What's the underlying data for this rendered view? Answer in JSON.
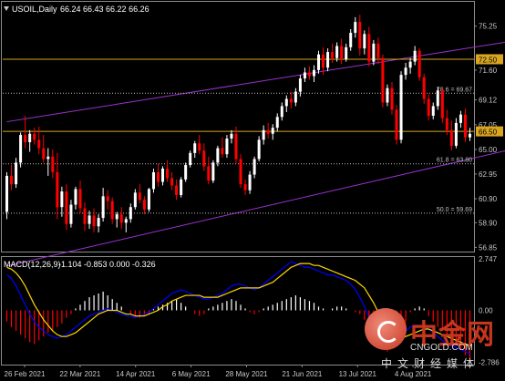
{
  "header": {
    "symbol": "USOIL,Daily",
    "ohlc": "66.24 66.43 66.22 66.26"
  },
  "macd_header": {
    "label": "MACD(12,26,9)",
    "values": "-1.104 -0.853 0.000 -0.326"
  },
  "colors": {
    "background": "#000000",
    "bull": "#ffffff",
    "bear": "#ff0000",
    "channel": "#9932cc",
    "hline": "#daa520",
    "fib": "#c0c0c0",
    "macd_hist_up": "#ffffff",
    "macd_hist_down": "#ff0000",
    "macd_line": "#0000ff",
    "signal_line": "#ffd700",
    "axis_text": "#c8c8c8"
  },
  "watermark": {
    "title": "中金网",
    "url": "CNGOLD.COM",
    "subtitle": "中文财经媒体"
  },
  "chart_data": [
    {
      "type": "candlestick",
      "title": "USOIL,Daily",
      "ylim": [
        56.5,
        77.2
      ],
      "y_ticks": [
        "75.25",
        "72.50",
        "71.60",
        "69.12",
        "67.05",
        "66.50",
        "65.00",
        "62.95",
        "60.90",
        "58.90",
        "56.85"
      ],
      "x_ticks": [
        "26 Feb 2021",
        "22 Mar 2021",
        "14 Apr 2021",
        "6 May 2021",
        "28 May 2021",
        "21 Jun 2021",
        "13 Jul 2021",
        "4 Aug 2021"
      ],
      "price_tags": [
        {
          "label": "72.50",
          "value": 72.5
        },
        {
          "label": "66.50",
          "value": 66.5
        }
      ],
      "horizontal_lines": [
        72.5,
        66.5
      ],
      "fib_levels": [
        {
          "label": "78.6 = 69.67",
          "value": 69.67
        },
        {
          "label": "61.8 = 63.80",
          "value": 63.8
        },
        {
          "label": "50.0 = 59.69",
          "value": 59.69
        }
      ],
      "channel": {
        "upper": [
          [
            0,
            67.3
          ],
          [
            161,
            77.1
          ]
        ],
        "lower": [
          [
            0,
            55.3
          ],
          [
            160,
            69.4
          ]
        ]
      },
      "candles": [
        [
          59.8,
          63.1,
          59.2,
          62.8
        ],
        [
          62.8,
          63.7,
          61.6,
          62.1
        ],
        [
          62.1,
          64.3,
          61.8,
          63.9
        ],
        [
          63.9,
          66.4,
          63.5,
          66.2
        ],
        [
          66.2,
          67.8,
          65.1,
          65.6
        ],
        [
          65.6,
          66.6,
          64.8,
          66.3
        ],
        [
          66.3,
          66.8,
          65.4,
          65.8
        ],
        [
          65.8,
          66.9,
          64.6,
          65.1
        ],
        [
          65.1,
          66.2,
          63.9,
          64.2
        ],
        [
          64.2,
          65.1,
          62.8,
          64.4
        ],
        [
          64.4,
          65.0,
          62.6,
          63.1
        ],
        [
          63.1,
          64.7,
          59.2,
          60.2
        ],
        [
          60.2,
          61.9,
          59.4,
          61.5
        ],
        [
          61.5,
          62.1,
          58.3,
          58.8
        ],
        [
          58.8,
          60.8,
          58.5,
          60.4
        ],
        [
          60.4,
          61.9,
          60.0,
          61.7
        ],
        [
          61.7,
          62.4,
          59.7,
          60.1
        ],
        [
          60.1,
          60.6,
          58.2,
          58.8
        ],
        [
          58.8,
          59.9,
          58.4,
          59.5
        ],
        [
          59.5,
          60.1,
          58.1,
          58.6
        ],
        [
          58.6,
          59.6,
          58.1,
          59.3
        ],
        [
          59.3,
          61.8,
          59.0,
          61.1
        ],
        [
          61.1,
          61.6,
          60.0,
          60.7
        ],
        [
          60.7,
          61.0,
          58.8,
          59.2
        ],
        [
          59.2,
          59.8,
          58.5,
          59.6
        ],
        [
          59.6,
          60.2,
          58.4,
          58.9
        ],
        [
          58.9,
          59.4,
          58.1,
          59.2
        ],
        [
          59.2,
          60.5,
          58.9,
          60.2
        ],
        [
          60.2,
          61.7,
          60.0,
          61.4
        ],
        [
          61.4,
          62.1,
          60.5,
          60.8
        ],
        [
          60.8,
          61.1,
          59.6,
          60.0
        ],
        [
          60.0,
          61.8,
          59.8,
          61.7
        ],
        [
          61.7,
          63.4,
          61.4,
          63.1
        ],
        [
          63.1,
          63.8,
          61.9,
          62.3
        ],
        [
          62.3,
          63.6,
          62.0,
          63.4
        ],
        [
          63.4,
          64.1,
          62.3,
          62.6
        ],
        [
          62.6,
          63.1,
          61.6,
          62.0
        ],
        [
          62.0,
          62.5,
          60.8,
          61.2
        ],
        [
          61.2,
          62.7,
          61.0,
          62.5
        ],
        [
          62.5,
          63.9,
          62.3,
          63.7
        ],
        [
          63.7,
          64.9,
          63.5,
          64.7
        ],
        [
          64.7,
          65.7,
          64.3,
          65.5
        ],
        [
          65.5,
          66.2,
          64.6,
          64.9
        ],
        [
          64.9,
          65.5,
          63.2,
          63.6
        ],
        [
          63.6,
          64.4,
          62.1,
          62.4
        ],
        [
          62.4,
          64.1,
          62.2,
          63.9
        ],
        [
          63.9,
          65.3,
          63.6,
          65.1
        ],
        [
          65.1,
          66.0,
          64.3,
          64.6
        ],
        [
          64.6,
          66.2,
          64.3,
          65.9
        ],
        [
          65.9,
          66.6,
          65.5,
          66.3
        ],
        [
          66.3,
          66.9,
          63.8,
          64.2
        ],
        [
          64.2,
          64.6,
          61.8,
          62.1
        ],
        [
          62.1,
          62.5,
          61.2,
          61.6
        ],
        [
          61.6,
          63.2,
          61.3,
          62.9
        ],
        [
          62.9,
          64.4,
          62.6,
          64.2
        ],
        [
          64.2,
          66.1,
          64.0,
          65.8
        ],
        [
          65.8,
          67.0,
          65.4,
          66.6
        ],
        [
          66.6,
          67.2,
          65.9,
          66.3
        ],
        [
          66.3,
          67.1,
          65.8,
          66.8
        ],
        [
          66.8,
          68.0,
          66.5,
          67.7
        ],
        [
          67.7,
          68.9,
          67.4,
          68.6
        ],
        [
          68.6,
          69.5,
          68.1,
          69.2
        ],
        [
          69.2,
          69.8,
          68.4,
          68.9
        ],
        [
          68.9,
          70.1,
          68.6,
          69.8
        ],
        [
          69.8,
          71.2,
          69.4,
          70.9
        ],
        [
          70.9,
          71.8,
          70.6,
          71.4
        ],
        [
          71.4,
          71.9,
          70.8,
          71.1
        ],
        [
          71.1,
          72.0,
          70.6,
          71.6
        ],
        [
          71.6,
          73.2,
          71.3,
          72.9
        ],
        [
          72.9,
          73.5,
          71.2,
          71.8
        ],
        [
          71.8,
          73.4,
          71.5,
          73.1
        ],
        [
          73.1,
          73.8,
          72.2,
          72.6
        ],
        [
          72.6,
          73.9,
          72.3,
          73.6
        ],
        [
          73.6,
          74.2,
          72.1,
          72.5
        ],
        [
          72.5,
          73.8,
          72.3,
          73.5
        ],
        [
          73.5,
          75.0,
          73.2,
          74.7
        ],
        [
          74.7,
          76.0,
          74.3,
          75.6
        ],
        [
          75.6,
          76.2,
          72.8,
          73.4
        ],
        [
          73.4,
          74.9,
          72.9,
          74.6
        ],
        [
          74.6,
          75.2,
          71.9,
          72.3
        ],
        [
          72.3,
          74.1,
          72.0,
          73.8
        ],
        [
          73.8,
          74.3,
          72.1,
          72.6
        ],
        [
          72.6,
          72.9,
          68.5,
          68.9
        ],
        [
          68.9,
          70.4,
          68.6,
          70.1
        ],
        [
          70.1,
          70.6,
          67.9,
          68.3
        ],
        [
          68.3,
          68.7,
          65.4,
          65.8
        ],
        [
          65.8,
          71.5,
          65.5,
          71.2
        ],
        [
          71.2,
          72.2,
          70.8,
          71.8
        ],
        [
          71.8,
          72.6,
          71.3,
          72.3
        ],
        [
          72.3,
          73.6,
          72.0,
          73.2
        ],
        [
          73.2,
          73.4,
          70.7,
          71.0
        ],
        [
          71.0,
          71.3,
          68.8,
          69.2
        ],
        [
          69.2,
          69.6,
          67.4,
          67.8
        ],
        [
          67.8,
          68.9,
          67.5,
          68.6
        ],
        [
          68.6,
          70.2,
          68.3,
          69.9
        ],
        [
          69.9,
          70.1,
          67.2,
          67.6
        ],
        [
          67.6,
          68.3,
          66.2,
          66.6
        ],
        [
          66.6,
          67.4,
          64.9,
          65.3
        ],
        [
          65.3,
          67.6,
          65.1,
          67.2
        ],
        [
          67.2,
          68.2,
          66.8,
          67.9
        ],
        [
          67.9,
          68.4,
          65.6,
          66.0
        ],
        [
          66.0,
          66.8,
          65.7,
          66.3
        ]
      ]
    },
    {
      "type": "bar+line",
      "title": "MACD(12,26,9)",
      "ylim": [
        -2.9,
        2.8
      ],
      "y_ticks": [
        "2.747",
        "0.00",
        "-2.786"
      ],
      "histogram": [
        -0.6,
        -0.9,
        -1.1,
        -1.3,
        -1.5,
        -1.7,
        -1.8,
        -1.6,
        -1.4,
        -1.2,
        -1.1,
        -0.9,
        -0.7,
        -0.4,
        -0.2,
        0.1,
        0.3,
        0.5,
        0.7,
        0.8,
        0.9,
        1.0,
        0.8,
        0.6,
        0.4,
        0.2,
        0.0,
        -0.2,
        -0.3,
        -0.4,
        -0.3,
        -0.2,
        0.1,
        0.2,
        0.3,
        0.4,
        0.5,
        0.6,
        0.4,
        0.2,
        0.0,
        -0.2,
        -0.3,
        -0.2,
        0.1,
        0.2,
        0.3,
        0.4,
        0.5,
        0.6,
        0.5,
        0.3,
        0.1,
        -0.1,
        -0.2,
        -0.1,
        0.1,
        0.2,
        0.3,
        0.4,
        0.5,
        0.6,
        0.7,
        0.8,
        0.7,
        0.6,
        0.5,
        0.4,
        0.2,
        0.1,
        0.0,
        0.1,
        0.2,
        0.2,
        0.1,
        0.0,
        -0.1,
        -0.2,
        -0.5,
        -0.9,
        -1.3,
        -1.7,
        -2.0,
        -2.2,
        -2.0,
        -1.6,
        -1.2,
        -0.6,
        -0.1,
        0.1,
        0.2,
        0.1,
        -0.3,
        -0.6,
        -0.9,
        -1.1,
        -1.4,
        -1.6,
        -1.8,
        -2.1,
        -2.4,
        -2.6
      ],
      "macd_line": [
        1.9,
        1.7,
        1.3,
        0.8,
        0.3,
        -0.2,
        -0.6,
        -0.9,
        -1.1,
        -1.3,
        -1.4,
        -1.5,
        -1.4,
        -1.3,
        -1.1,
        -0.9,
        -0.7,
        -0.5,
        -0.3,
        -0.2,
        -0.1,
        0.0,
        0.1,
        0.0,
        -0.1,
        -0.2,
        -0.3,
        -0.3,
        -0.4,
        -0.3,
        -0.2,
        -0.1,
        0.1,
        0.3,
        0.5,
        0.7,
        0.9,
        1.0,
        1.1,
        1.0,
        0.9,
        0.8,
        0.7,
        0.6,
        0.6,
        0.7,
        0.8,
        0.9,
        1.1,
        1.3,
        1.4,
        1.4,
        1.3,
        1.2,
        1.1,
        1.2,
        1.4,
        1.6,
        1.8,
        2.0,
        2.2,
        2.4,
        2.6,
        2.5,
        2.4,
        2.3,
        2.3,
        2.2,
        2.1,
        2.0,
        1.9,
        1.9,
        1.8,
        1.7,
        1.6,
        1.4,
        1.1,
        0.7,
        0.2,
        -0.4,
        -0.9,
        -1.4,
        -1.8,
        -2.0,
        -1.9,
        -1.7,
        -1.4,
        -1.1,
        -0.9,
        -0.8,
        -0.8,
        -0.9,
        -1.0,
        -1.2,
        -1.4,
        -1.6,
        -1.8,
        -1.9,
        -2.0,
        -2.1,
        -2.2,
        -2.3
      ],
      "signal_line": [
        2.3,
        2.2,
        2.0,
        1.7,
        1.3,
        0.8,
        0.3,
        -0.1,
        -0.5,
        -0.8,
        -1.1,
        -1.3,
        -1.4,
        -1.4,
        -1.3,
        -1.2,
        -1.0,
        -0.8,
        -0.6,
        -0.4,
        -0.2,
        -0.1,
        0.0,
        0.0,
        0.0,
        -0.1,
        -0.2,
        -0.2,
        -0.3,
        -0.3,
        -0.3,
        -0.2,
        -0.1,
        0.0,
        0.2,
        0.3,
        0.5,
        0.6,
        0.7,
        0.8,
        0.8,
        0.8,
        0.8,
        0.7,
        0.7,
        0.7,
        0.7,
        0.8,
        0.9,
        1.0,
        1.1,
        1.2,
        1.2,
        1.2,
        1.2,
        1.2,
        1.3,
        1.4,
        1.5,
        1.7,
        1.9,
        2.1,
        2.3,
        2.4,
        2.5,
        2.5,
        2.5,
        2.4,
        2.4,
        2.3,
        2.2,
        2.1,
        2.0,
        1.9,
        1.8,
        1.7,
        1.6,
        1.4,
        1.2,
        0.8,
        0.4,
        -0.1,
        -0.6,
        -1.0,
        -1.3,
        -1.5,
        -1.5,
        -1.4,
        -1.3,
        -1.2,
        -1.1,
        -1.0,
        -1.0,
        -1.1,
        -1.2,
        -1.3,
        -1.4,
        -1.5,
        -1.6,
        -1.7,
        -1.8,
        -1.9
      ]
    }
  ]
}
